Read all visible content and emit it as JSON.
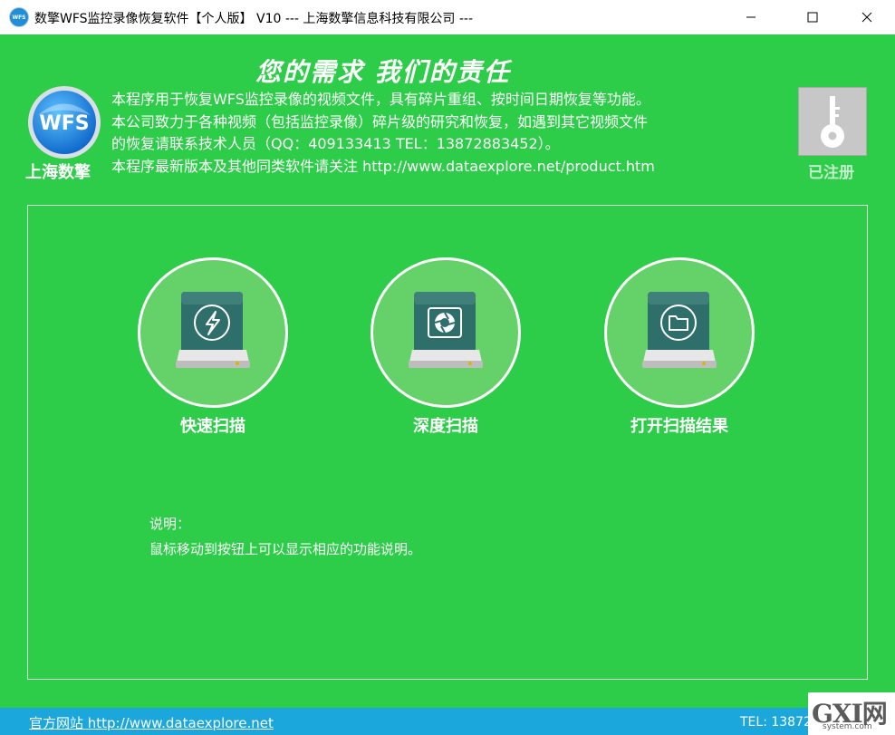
{
  "window": {
    "app_icon_text": "WFS",
    "title": "数擎WFS监控录像恢复软件【个人版】 V10  --- 上海数擎信息科技有限公司 ---"
  },
  "header": {
    "slogan": "您的需求   我们的责任",
    "logo_badge": "WFS",
    "logo_text": "上海数擎",
    "intro_lines": [
      "本程序用于恢复WFS监控录像的视频文件，具有碎片重组、按时间日期恢复等功能。",
      "本公司致力于各种视频（包括监控录像）碎片级的研究和恢复，如遇到其它视频文件",
      "的恢复请联系技术人员（QQ：409133413  TEL：13872883452）。",
      "本程序最新版本及其他同类软件请关注 http://www.dataexplore.net/product.htm"
    ],
    "registration": {
      "icon": "key-icon",
      "label": "已注册"
    }
  },
  "actions": [
    {
      "label": "快速扫描",
      "icon": "lightning-icon"
    },
    {
      "label": "深度扫描",
      "icon": "aperture-icon"
    },
    {
      "label": "打开扫描结果",
      "icon": "folder-icon"
    }
  ],
  "description": {
    "title": "说明：",
    "text": "鼠标移动到按钮上可以显示相应的功能说明。"
  },
  "footer": {
    "site_link": "官方网站 http://www.dataexplore.net",
    "tel": "TEL: 13872",
    "watermark_main": "GXI网",
    "watermark_sub": "system.com"
  },
  "colors": {
    "background": "#2dcc49",
    "button_circle": "#64d268",
    "statusbar": "#1ba7dc",
    "drive_face": "#2f6f6b"
  }
}
